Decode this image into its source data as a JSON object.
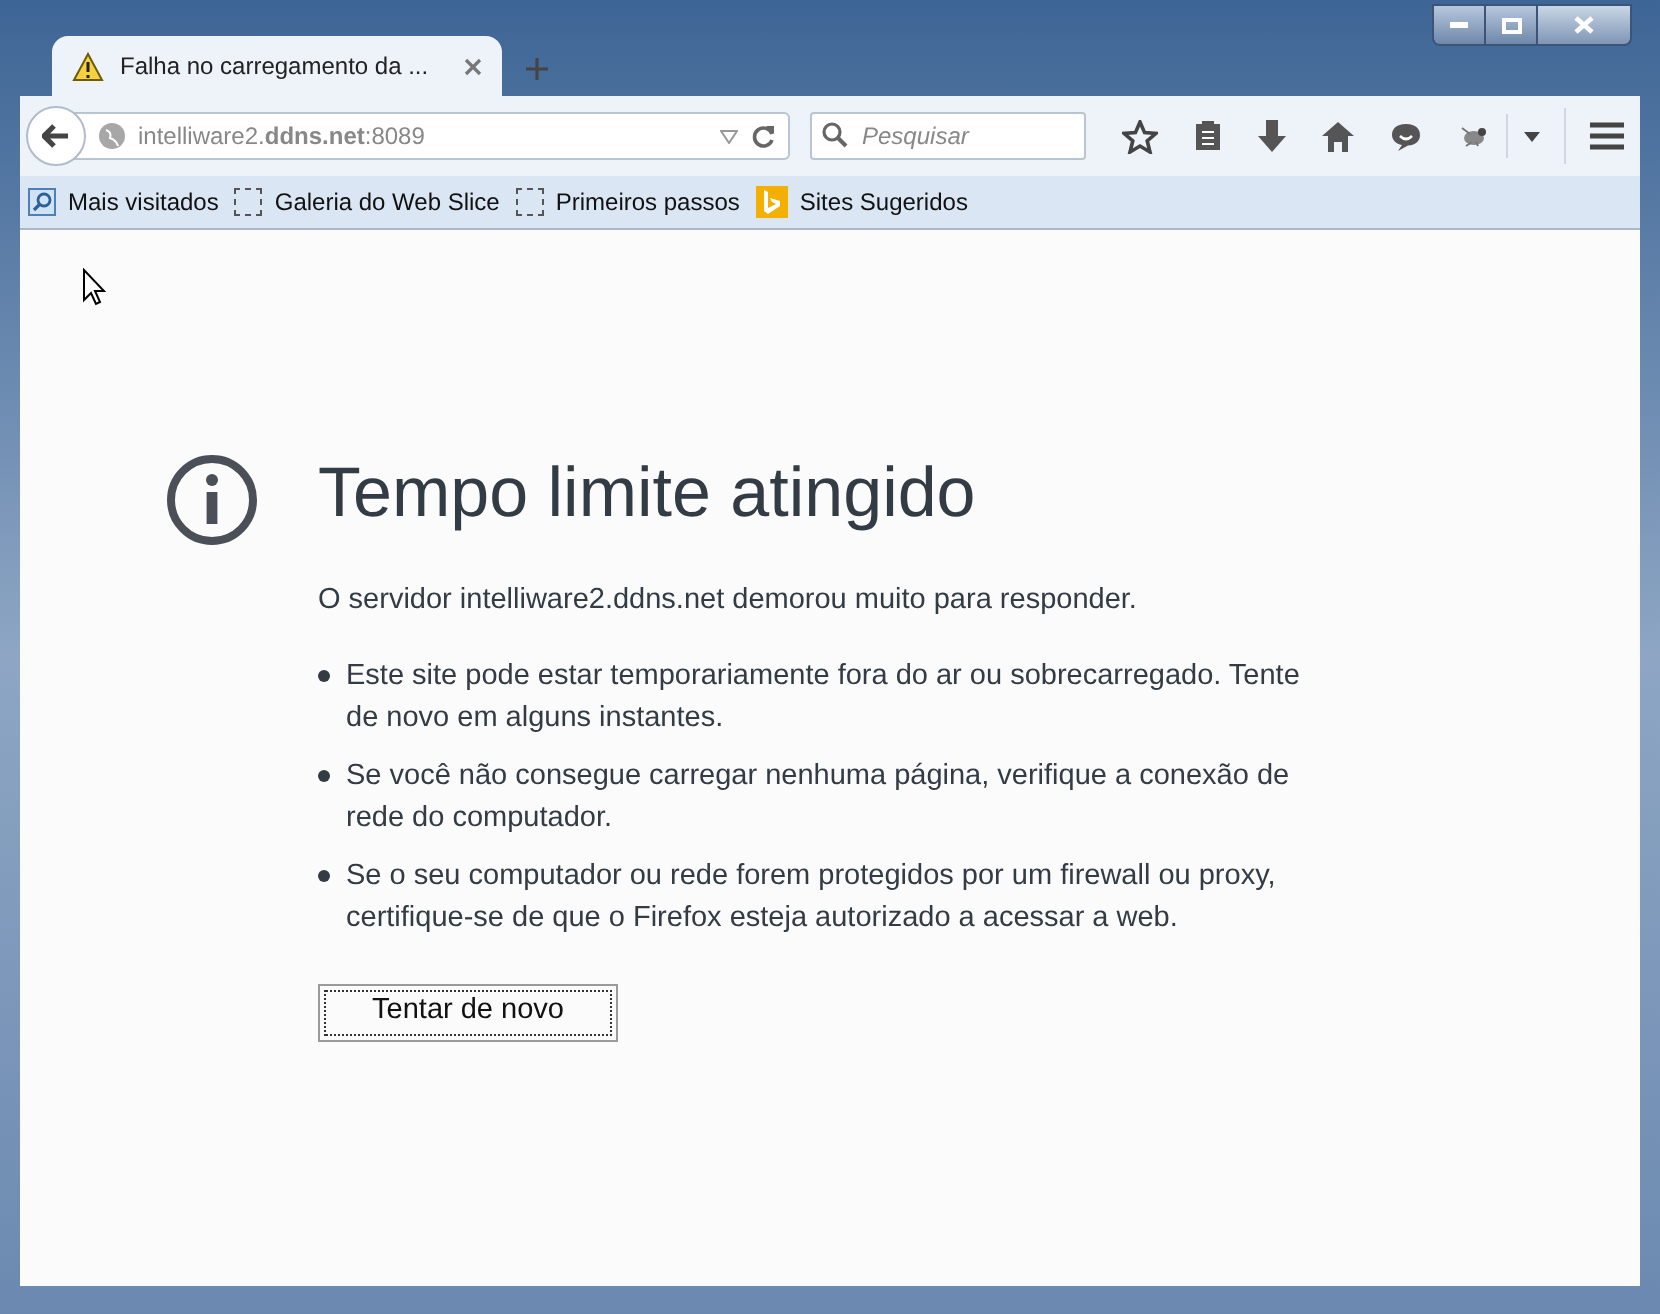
{
  "window": {
    "controls": [
      {
        "kind": "minimize"
      },
      {
        "kind": "maximize"
      },
      {
        "kind": "close"
      }
    ]
  },
  "tabs": [
    {
      "title": "Falha no carregamento da ...",
      "selected": true
    }
  ],
  "url_bar": {
    "url": "intelliware2.**ddns.net**:8089"
  },
  "search": {
    "placeholder": "Pesquisar"
  },
  "bookmarks": [
    {
      "label": "Mais visitados",
      "kind": "search"
    },
    {
      "label": "Galeria do Web Slice",
      "kind": "slice"
    },
    {
      "label": "Primeiros passos",
      "kind": "slice"
    },
    {
      "label": "Sites Sugeridos",
      "kind": "bing"
    }
  ],
  "error": {
    "title": "Tempo limite atingido",
    "message": "O servidor intelliware2.ddns.net demorou muito para responder.",
    "bullets": [
      "Este site pode estar temporariamente fora do ar ou sobrecarregado. Tente de novo em alguns instantes.",
      "Se você não consegue carregar nenhuma página, verifique a conexão de rede do computador.",
      "Se o seu computador ou rede forem protegidos por um firewall ou proxy, certifique-se de que o Firefox esteja autorizado a acessar a web."
    ],
    "button": "Tentar de novo"
  }
}
